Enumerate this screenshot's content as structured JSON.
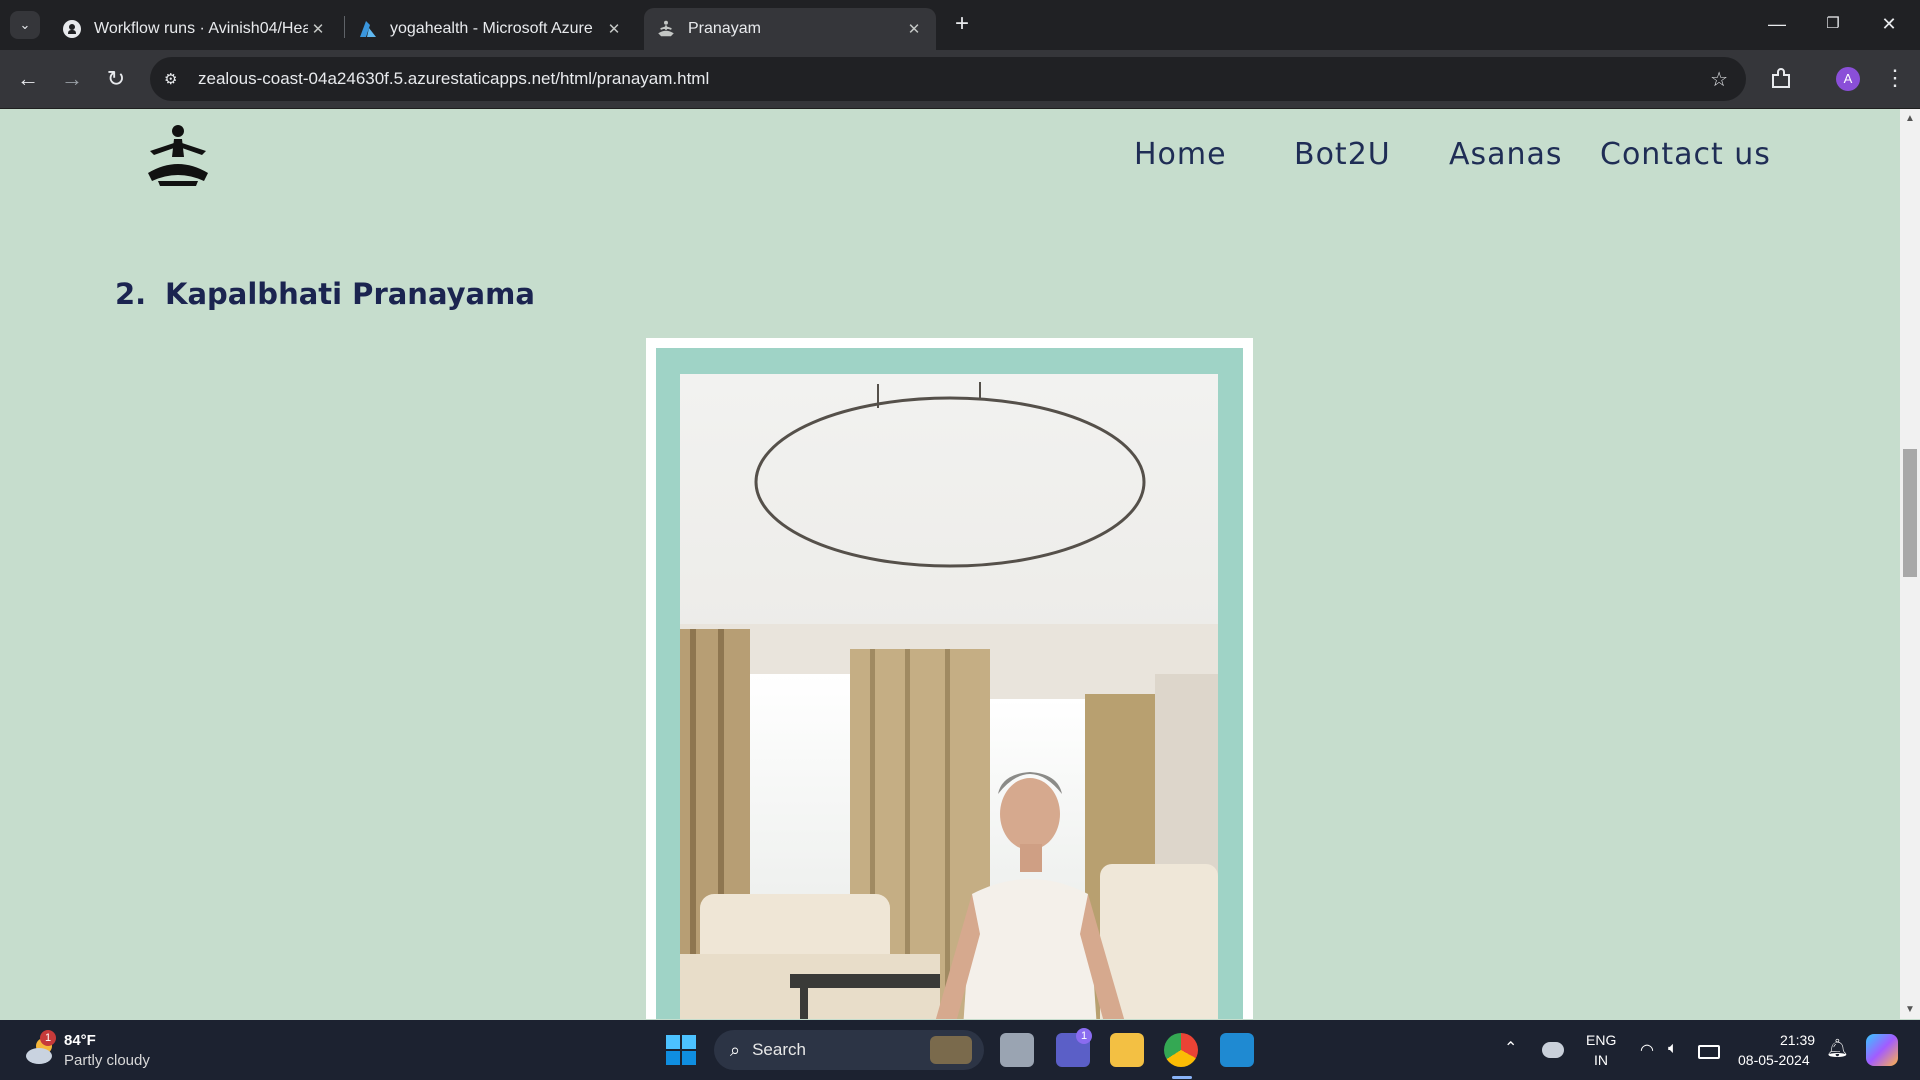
{
  "browser": {
    "tabs": [
      {
        "title": "Workflow runs · Avinish04/Heal",
        "icon": "github-icon",
        "active": false
      },
      {
        "title": "yogahealth - Microsoft Azure",
        "icon": "azure-icon",
        "active": false
      },
      {
        "title": "Pranayam",
        "icon": "yoga-favicon",
        "active": true
      }
    ],
    "url": "zealous-coast-04a24630f.5.azurestaticapps.net/html/pranayam.html",
    "profile_initial": "A"
  },
  "page": {
    "nav": {
      "home": "Home",
      "bot": "Bot2U",
      "asanas": "Asanas",
      "contact": "Contact us"
    },
    "section": {
      "number": "2.",
      "title": "Kapalbhati Pranayama"
    },
    "colors": {
      "background": "#c6ddcd",
      "frame_inner": "#9fd3c6",
      "heading": "#1b2450"
    }
  },
  "taskbar": {
    "weather_temp": "84°F",
    "weather_desc": "Partly cloudy",
    "weather_badge": "1",
    "search_label": "Search",
    "teams_badge": "1",
    "lang_top": "ENG",
    "lang_bottom": "IN",
    "time": "21:39",
    "date": "08-05-2024"
  }
}
